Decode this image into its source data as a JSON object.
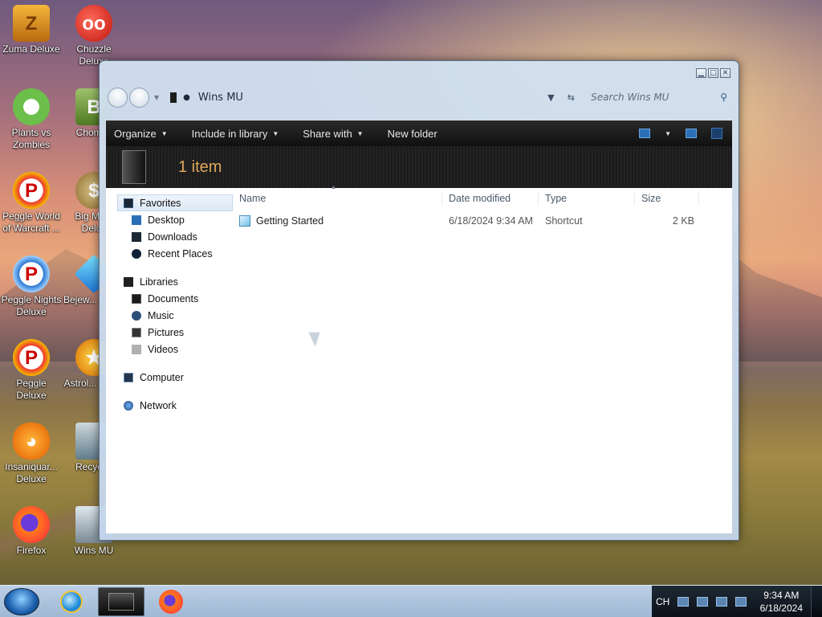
{
  "desktop": {
    "icons": [
      {
        "label": "Zuma Deluxe",
        "glyph": "Z"
      },
      {
        "label": "Chuzzle Deluxe",
        "glyph": "oo"
      },
      {
        "label": "Plants vs Zombies",
        "glyph": "✿"
      },
      {
        "label": "Chomi...",
        "glyph": "B"
      },
      {
        "label": "Peggle World of Warcraft ...",
        "glyph": "P"
      },
      {
        "label": "Big Mo... Delux",
        "glyph": "$"
      },
      {
        "label": "Peggle Nights Deluxe",
        "glyph": "P"
      },
      {
        "label": "Bejew... Delux",
        "glyph": ""
      },
      {
        "label": "Peggle Deluxe",
        "glyph": "P"
      },
      {
        "label": "Astrol... Delux",
        "glyph": "★"
      },
      {
        "label": "Insaniquar... Deluxe",
        "glyph": "◕"
      },
      {
        "label": "Recycl...",
        "glyph": ""
      },
      {
        "label": "Firefox",
        "glyph": ""
      },
      {
        "label": "Wins MU",
        "glyph": ""
      }
    ]
  },
  "window": {
    "address": "Wins MU",
    "search_placeholder": "Search Wins MU",
    "toolbar": {
      "organize": "Organize",
      "include": "Include in library",
      "share": "Share with",
      "new_folder": "New folder"
    },
    "banner_count": "1 item",
    "nav": {
      "favorites": "Favorites",
      "favorites_items": [
        "Desktop",
        "Downloads",
        "Recent Places"
      ],
      "libraries": "Libraries",
      "libraries_items": [
        "Documents",
        "Music",
        "Pictures",
        "Videos"
      ],
      "computer": "Computer",
      "network": "Network"
    },
    "columns": {
      "name": "Name",
      "date": "Date modified",
      "type": "Type",
      "size": "Size"
    },
    "files": [
      {
        "name": "Getting Started",
        "date": "6/18/2024 9:34 AM",
        "type": "Shortcut",
        "size": "2 KB"
      }
    ]
  },
  "taskbar": {
    "lang": "CH",
    "time": "9:34 AM",
    "date": "6/18/2024"
  }
}
